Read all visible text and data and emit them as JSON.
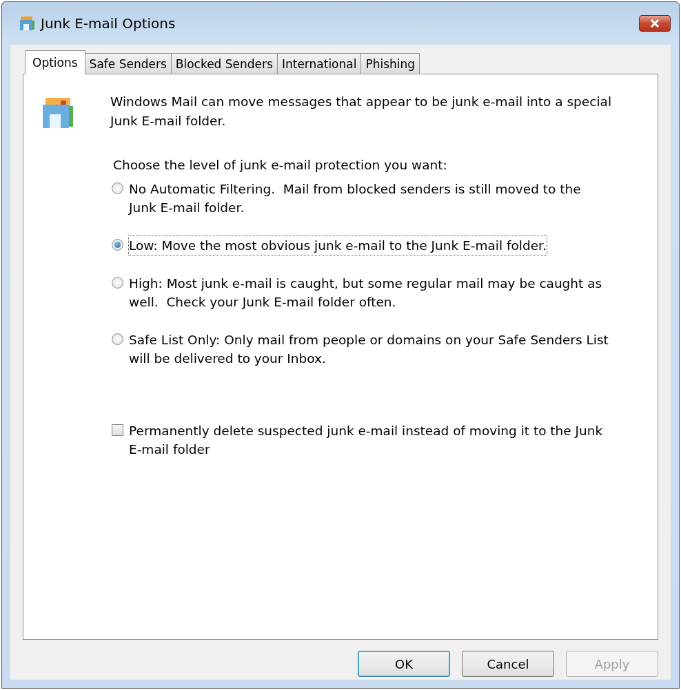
{
  "window": {
    "title": "Junk E-mail Options"
  },
  "tabs": [
    {
      "label": "Options",
      "selected": true
    },
    {
      "label": "Safe Senders",
      "selected": false
    },
    {
      "label": "Blocked Senders",
      "selected": false
    },
    {
      "label": "International",
      "selected": false
    },
    {
      "label": "Phishing",
      "selected": false
    }
  ],
  "intro": "Windows Mail can move messages that appear to be junk e-mail into a special Junk E-mail folder.",
  "prompt": "Choose the level of junk e-mail protection you want:",
  "levels": [
    {
      "label": "No Automatic Filtering.  Mail from blocked senders is still moved to the Junk E-mail folder.",
      "selected": false,
      "focused": false
    },
    {
      "label": "Low: Move the most obvious junk e-mail to the Junk E-mail folder.",
      "selected": true,
      "focused": true
    },
    {
      "label": "High: Most junk e-mail is caught, but some regular mail may be caught as well.  Check your Junk E-mail folder often.",
      "selected": false,
      "focused": false
    },
    {
      "label": "Safe List Only: Only mail from people or domains on your Safe Senders List will be delivered to your Inbox.",
      "selected": false,
      "focused": false
    }
  ],
  "delete_option": {
    "label": "Permanently delete suspected junk e-mail instead of moving it to the Junk E-mail folder",
    "checked": false
  },
  "buttons": [
    {
      "label": "OK",
      "default": true,
      "disabled": false
    },
    {
      "label": "Cancel",
      "default": false,
      "disabled": false
    },
    {
      "label": "Apply",
      "default": false,
      "disabled": true
    }
  ]
}
